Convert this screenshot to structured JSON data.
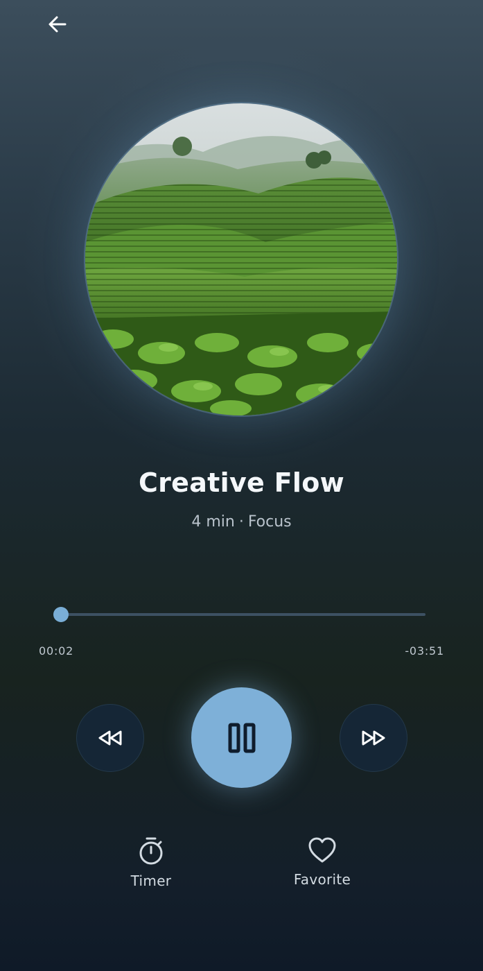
{
  "header": {
    "back_icon": "arrow-left-icon"
  },
  "artwork": {
    "description_icon": "tea-field-artwork"
  },
  "track": {
    "title": "Creative Flow",
    "duration": "4 min",
    "separator": "·",
    "category": "Focus"
  },
  "player": {
    "elapsed": "00:02",
    "remaining": "-03:51",
    "progress_fraction": 0.0,
    "accent_color": "#7eb0d8",
    "rewind_icon": "rewind-icon",
    "pause_icon": "pause-icon",
    "forward_icon": "fast-forward-icon"
  },
  "actions": {
    "timer_label": "Timer",
    "timer_icon": "timer-icon",
    "favorite_label": "Favorite",
    "favorite_icon": "heart-icon"
  }
}
